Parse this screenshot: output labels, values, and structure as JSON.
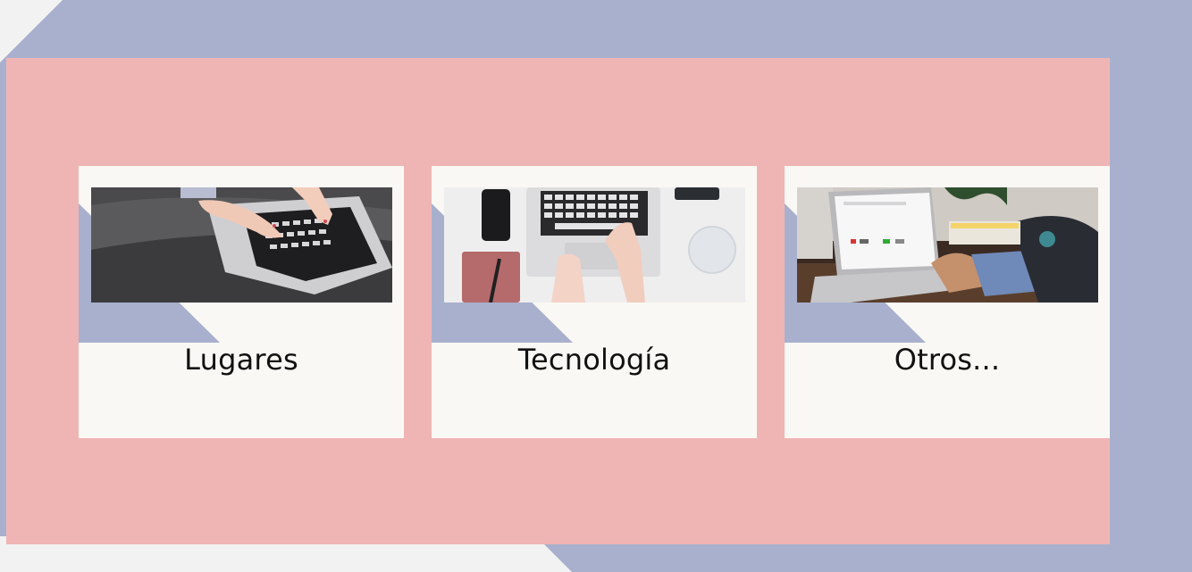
{
  "colors": {
    "background": "#a8b0cd",
    "panel": "#efb5b4",
    "card": "#faf8f4",
    "accent_triangle": "#a8b0cd",
    "corner": "#f2f2f2"
  },
  "cards": [
    {
      "title": "Lugares",
      "image_icon": "laptop-typing-photo"
    },
    {
      "title": "Tecnología",
      "image_icon": "laptop-desk-photo"
    },
    {
      "title": "Otros...",
      "image_icon": "laptop-browser-photo"
    }
  ]
}
